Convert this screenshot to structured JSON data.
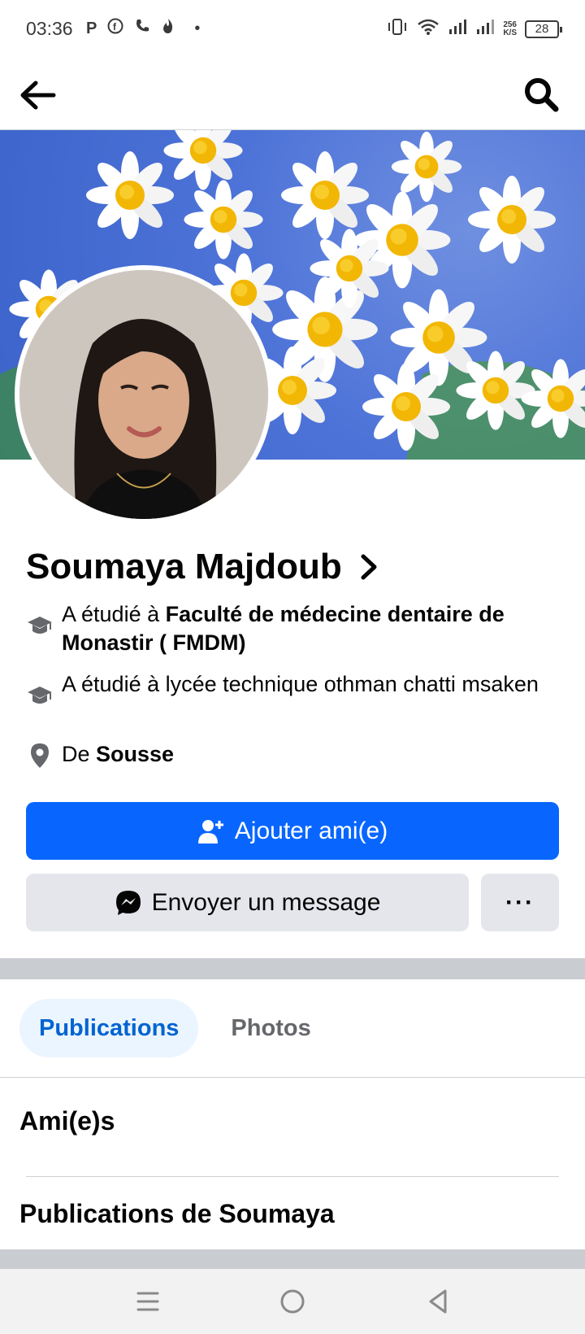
{
  "status_bar": {
    "time": "03:36",
    "left_icons": [
      "parking-icon",
      "facebook-icon",
      "phone-icon",
      "flame-icon",
      "dot-icon"
    ],
    "speed": "256",
    "speed_unit": "K/S",
    "battery": "28"
  },
  "profile": {
    "name": "Soumaya Majdoub",
    "info": [
      {
        "icon": "graduation-cap-icon",
        "prefix": "A étudié à ",
        "bold": "Faculté de médecine dentaire de Monastir ( FMDM)"
      },
      {
        "icon": "graduation-cap-icon",
        "prefix": "A étudié à lycée technique othman chatti msaken",
        "bold": ""
      },
      {
        "icon": "location-pin-icon",
        "prefix": "De ",
        "bold": "Sousse"
      }
    ]
  },
  "actions": {
    "add_friend": "Ajouter ami(e)",
    "message": "Envoyer un message",
    "more": "···"
  },
  "tabs": [
    {
      "label": "Publications",
      "active": true
    },
    {
      "label": "Photos",
      "active": false
    }
  ],
  "sections": {
    "friends": "Ami(e)s",
    "posts": "Publications de Soumaya"
  },
  "colors": {
    "primary": "#0866ff",
    "secondary_bg": "#e4e6eb",
    "tab_active_bg": "#ebf5ff",
    "tab_active_text": "#0064d1"
  }
}
